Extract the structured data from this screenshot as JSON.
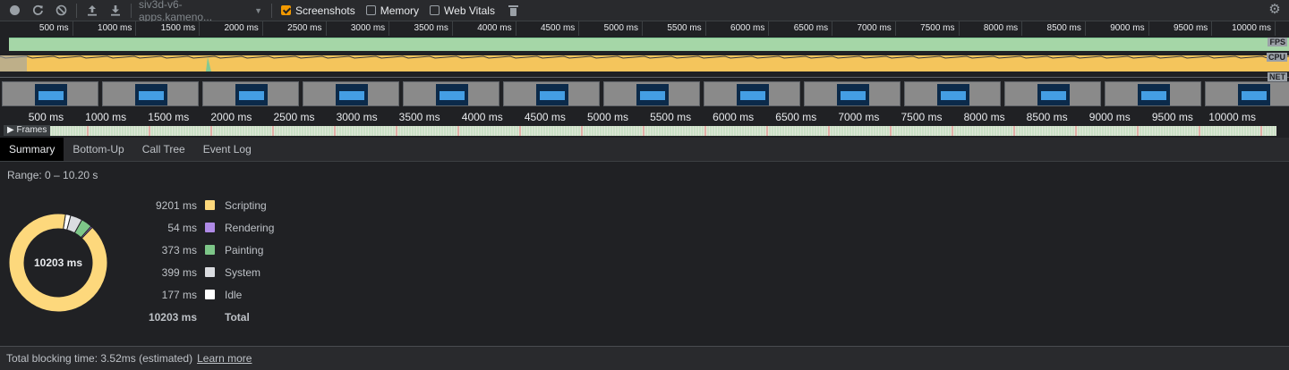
{
  "toolbar": {
    "profile_select": "siv3d-v6-apps.kameno...",
    "checkboxes": [
      {
        "label": "Screenshots",
        "checked": true
      },
      {
        "label": "Memory",
        "checked": false
      },
      {
        "label": "Web Vitals",
        "checked": false
      }
    ]
  },
  "overview": {
    "ticks_top": [
      "500 ms",
      "1000 ms",
      "1500 ms",
      "2000 ms",
      "2500 ms",
      "3000 ms",
      "3500 ms",
      "4000 ms",
      "4500 ms",
      "5000 ms",
      "5500 ms",
      "6000 ms",
      "6500 ms",
      "7000 ms",
      "7500 ms",
      "8000 ms",
      "8500 ms",
      "9000 ms",
      "9500 ms",
      "10000 ms"
    ],
    "lanes": {
      "fps": "FPS",
      "cpu": "CPU",
      "net": "NET"
    }
  },
  "ruler": {
    "ticks": [
      "500 ms",
      "1000 ms",
      "1500 ms",
      "2000 ms",
      "2500 ms",
      "3000 ms",
      "3500 ms",
      "4000 ms",
      "4500 ms",
      "5000 ms",
      "5500 ms",
      "6000 ms",
      "6500 ms",
      "7000 ms",
      "7500 ms",
      "8000 ms",
      "8500 ms",
      "9000 ms",
      "9500 ms",
      "10000 ms",
      "105"
    ]
  },
  "frames_label": "Frames",
  "tabs": [
    "Summary",
    "Bottom-Up",
    "Call Tree",
    "Event Log"
  ],
  "summary": {
    "range": "Range: 0 – 10.20 s",
    "total_center": "10203 ms",
    "items": [
      {
        "value": "9201 ms",
        "name": "Scripting",
        "ms": 9201,
        "color": "#fdd87c"
      },
      {
        "value": "54 ms",
        "name": "Rendering",
        "ms": 54,
        "color": "#af8ae6"
      },
      {
        "value": "373 ms",
        "name": "Painting",
        "ms": 373,
        "color": "#7dc688"
      },
      {
        "value": "399 ms",
        "name": "System",
        "ms": 399,
        "color": "#dadce0"
      },
      {
        "value": "177 ms",
        "name": "Idle",
        "ms": 177,
        "color": "#ffffff"
      }
    ],
    "total": {
      "value": "10203 ms",
      "name": "Total"
    }
  },
  "footer": {
    "text": "Total blocking time: 3.52ms (estimated)",
    "link": "Learn more"
  }
}
